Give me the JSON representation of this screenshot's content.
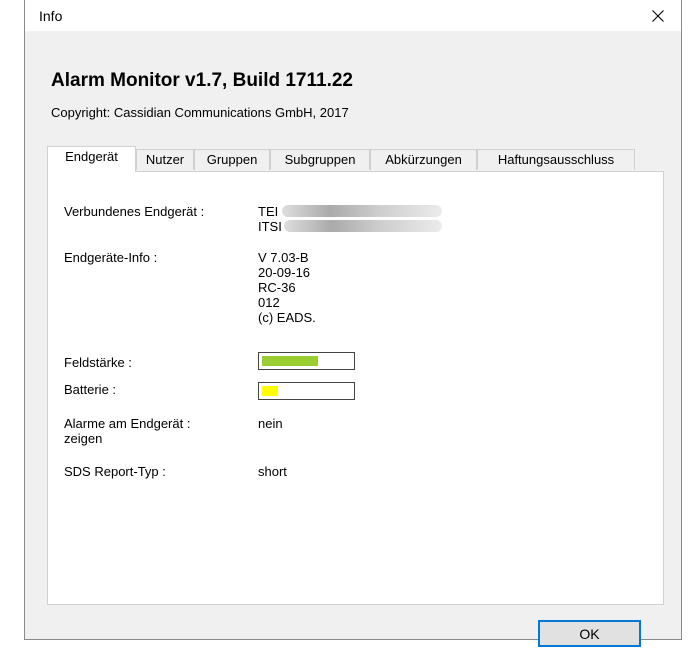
{
  "window": {
    "title": "Info",
    "close_icon": "close-icon"
  },
  "header": {
    "app_title": "Alarm Monitor v1.7, Build 1711.22",
    "copyright": "Copyright: Cassidian Communications GmbH, 2017"
  },
  "tabs": [
    {
      "label": "Endgerät",
      "active": true
    },
    {
      "label": "Nutzer",
      "active": false
    },
    {
      "label": "Gruppen",
      "active": false
    },
    {
      "label": "Subgruppen",
      "active": false
    },
    {
      "label": "Abkürzungen",
      "active": false
    },
    {
      "label": "Haftungsausschluss",
      "active": false
    }
  ],
  "device": {
    "connected_label": "Verbundenes Endgerät :",
    "tei_prefix": "TEI",
    "itsi_prefix": "ITSI",
    "info_label": "Endgeräte-Info :",
    "info_lines": [
      "V 7.03-B",
      "20-09-16",
      "RC-36",
      "012",
      "(c) EADS."
    ],
    "signal_label": "Feldstärke :",
    "signal_level": 0.63,
    "signal_color": "#9acd32",
    "battery_label": "Batterie :",
    "battery_level": 0.18,
    "battery_color": "#ffff00",
    "alarms_label_1": "Alarme am Endgerät :",
    "alarms_label_2": "zeigen",
    "alarms_value": "nein",
    "sds_label": "SDS Report-Typ :",
    "sds_value": "short"
  },
  "footer": {
    "ok_label": "OK"
  }
}
